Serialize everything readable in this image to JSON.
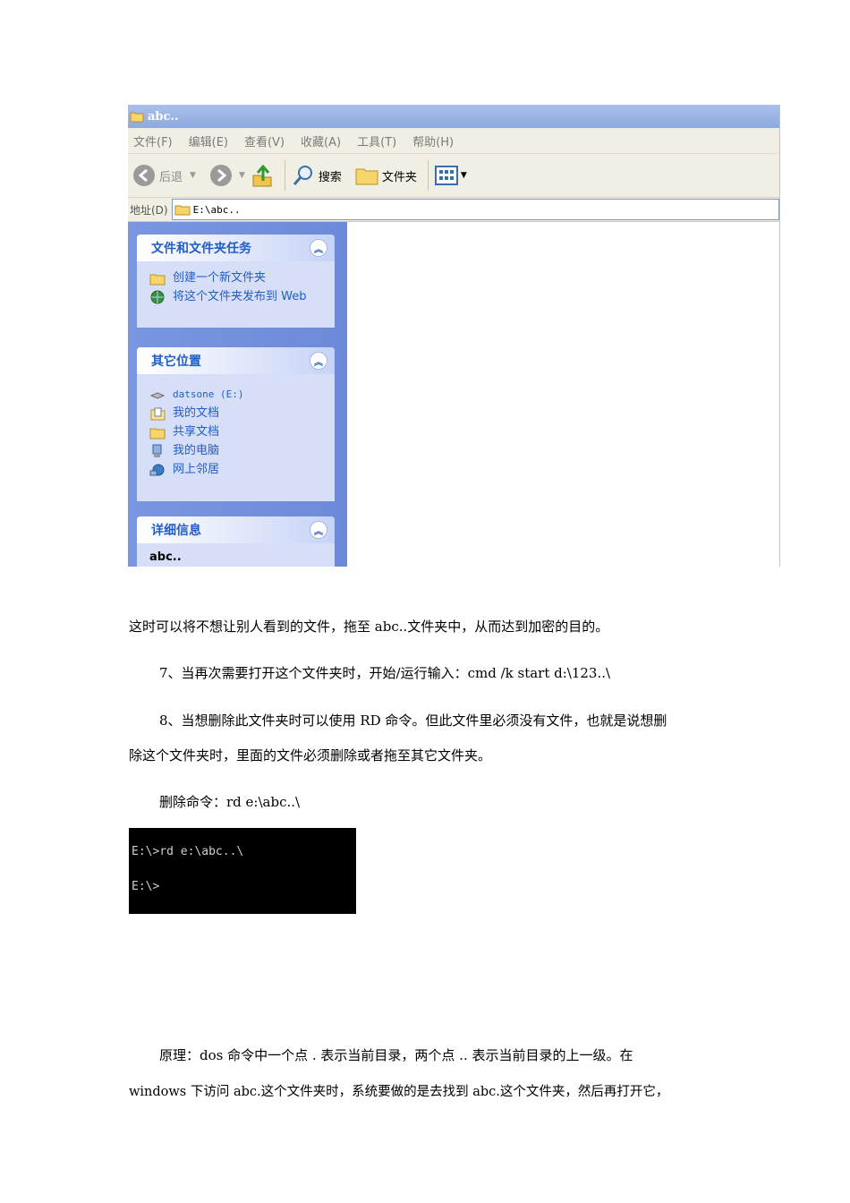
{
  "window": {
    "title": "abc..",
    "menu": [
      "文件(F)",
      "编辑(E)",
      "查看(V)",
      "收藏(A)",
      "工具(T)",
      "帮助(H)"
    ],
    "toolbar": {
      "back_label": "后退",
      "search_label": "搜索",
      "folders_label": "文件夹"
    },
    "address": {
      "label": "地址(D)",
      "value": "E:\\abc.."
    },
    "tasks_panel": {
      "title": "文件和文件夹任务",
      "items": [
        "创建一个新文件夹",
        "将这个文件夹发布到 Web"
      ]
    },
    "places_panel": {
      "title": "其它位置",
      "items": [
        "datsone (E:)",
        "我的文档",
        "共享文档",
        "我的电脑",
        "网上邻居"
      ]
    },
    "details_panel": {
      "title": "详细信息",
      "name": "abc.."
    }
  },
  "doc": {
    "p1": "这时可以将不想让别人看到的文件，拖至 abc..文件夹中，从而达到加密的目的。",
    "p2": "7、当再次需要打开这个文件夹时，开始/运行输入：cmd /k start d:\\123..\\",
    "p3_line1": "8、当想删除此文件夹时可以使用 RD 命令。但此文件里必须没有文件，也就是说想删",
    "p3_line2": "除这个文件夹时，里面的文件必须删除或者拖至其它文件夹。",
    "p4": "删除命令：rd e:\\abc..\\",
    "p5_line1": "原理：dos 命令中一个点 . 表示当前目录，两个点 .. 表示当前目录的上一级。在",
    "p5_line2": "windows 下访问 abc.这个文件夹时，系统要做的是去找到 abc.这个文件夹，然后再打开它，"
  },
  "console": {
    "line1": "E:\\>rd e:\\abc..\\",
    "line2": "E:\\>"
  }
}
